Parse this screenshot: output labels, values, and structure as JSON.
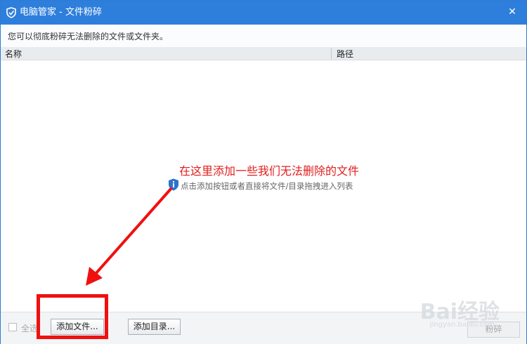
{
  "window": {
    "title": "电脑管家 - 文件粉碎",
    "close_glyph": "✕"
  },
  "description": "您可以彻底粉碎无法删除的文件或文件夹。",
  "table": {
    "columns": [
      "名称",
      "路径"
    ]
  },
  "empty_state": {
    "hint": "点击添加按钮或者直接将文件/目录拖拽进入列表",
    "icon": "info-shield-icon"
  },
  "annotation": {
    "text": "在这里添加一些我们无法删除的文件",
    "color": "#e21d1d"
  },
  "footer": {
    "select_all_label": "全选",
    "select_all_checked": false,
    "add_file_label": "添加文件...",
    "add_dir_label": "添加目录...",
    "shred_label": "粉碎"
  },
  "watermark": {
    "text": "Bai经验",
    "sub": "jingyan.baidu.com"
  },
  "colors": {
    "titlebar": "#2e7fdc",
    "highlight": "#f01010"
  }
}
